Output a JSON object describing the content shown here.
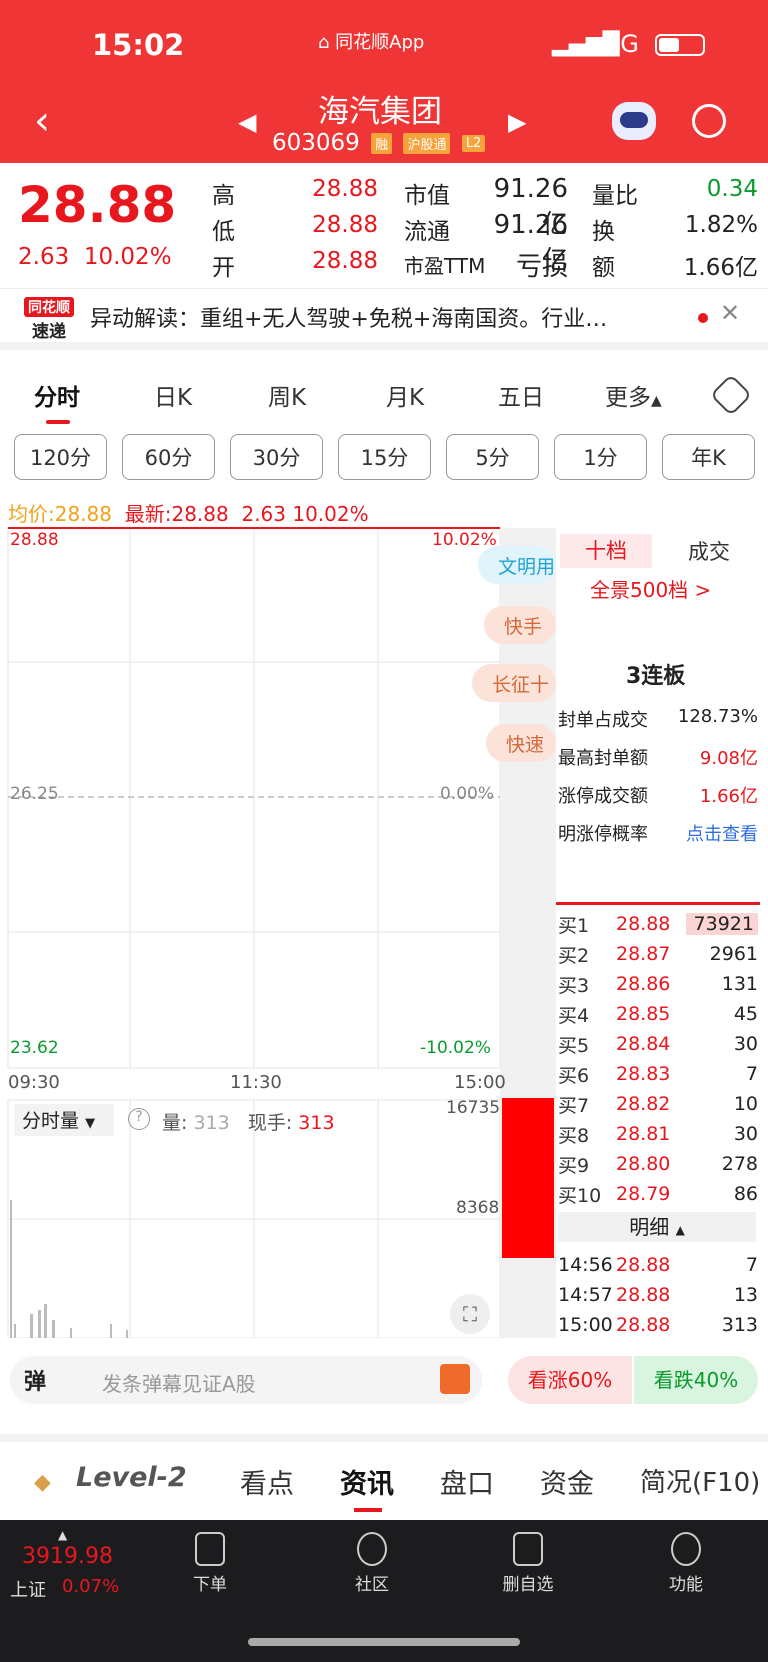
{
  "status_bar": {
    "time": "15:02",
    "app": "同花顺App",
    "network": "4G"
  },
  "header": {
    "name": "海汽集团",
    "code": "603069",
    "tags": [
      "融",
      "沪股通",
      "L2"
    ]
  },
  "quote": {
    "price": "28.88",
    "change": "2.63",
    "pct": "10.02%",
    "grid": [
      [
        "高",
        "28.88",
        "市值",
        "91.26亿",
        "量比",
        "0.34"
      ],
      [
        "低",
        "28.88",
        "流通",
        "91.26亿",
        "换",
        "1.82%"
      ],
      [
        "开",
        "28.88",
        "市盈TTM",
        "亏损",
        "额",
        "1.66亿"
      ]
    ]
  },
  "alert": {
    "logo1": "同花顺",
    "logo2": "速递",
    "text": "异动解读：重组+无人驾驶+免税+海南国资。行业…"
  },
  "tabs": [
    "分时",
    "日K",
    "周K",
    "月K",
    "五日",
    "更多"
  ],
  "periods": [
    "120分",
    "60分",
    "30分",
    "15分",
    "5分",
    "1分",
    "年K"
  ],
  "summary": {
    "avg_label": "均价:",
    "avg": "28.88",
    "latest_label": "最新:",
    "latest": "28.88",
    "chg": "2.63",
    "pct": "10.02%"
  },
  "chart_data": {
    "type": "line",
    "y_top": "28.88",
    "y_mid": "26.25",
    "y_bot": "23.62",
    "pct_top": "10.02%",
    "pct_mid": "0.00%",
    "pct_bot": "-10.02%",
    "x_labels": [
      "09:30",
      "11:30",
      "15:00"
    ],
    "series": [
      {
        "values": [
          28.88,
          28.88
        ]
      }
    ],
    "ylim": [
      23.62,
      28.88
    ]
  },
  "volume": {
    "selector": "分时量",
    "vol_label": "量:",
    "vol": "313",
    "hand_label": "现手:",
    "hand": "313",
    "max": "16735",
    "mid": "8368"
  },
  "news_pills": [
    "文明用",
    "快手",
    "长征十",
    "快速"
  ],
  "side": {
    "tab1": "十档",
    "tab2": "成交",
    "panorama": "全景500档 >",
    "board": "3连板",
    "stats": [
      [
        "封单占成交",
        "128.73%"
      ],
      [
        "最高封单额",
        "9.08亿"
      ],
      [
        "涨停成交额",
        "1.66亿"
      ],
      [
        "明涨停概率",
        "点击查看"
      ]
    ],
    "bids": [
      [
        "买1",
        "28.88",
        "73921"
      ],
      [
        "买2",
        "28.87",
        "2961"
      ],
      [
        "买3",
        "28.86",
        "131"
      ],
      [
        "买4",
        "28.85",
        "45"
      ],
      [
        "买5",
        "28.84",
        "30"
      ],
      [
        "买6",
        "28.83",
        "7"
      ],
      [
        "买7",
        "28.82",
        "10"
      ],
      [
        "买8",
        "28.81",
        "30"
      ],
      [
        "买9",
        "28.80",
        "278"
      ],
      [
        "买10",
        "28.79",
        "86"
      ]
    ],
    "detail_label": "明细",
    "trades": [
      [
        "14:56",
        "28.88",
        "7"
      ],
      [
        "14:57",
        "28.88",
        "13"
      ],
      [
        "15:00",
        "28.88",
        "313"
      ]
    ]
  },
  "danmu": {
    "icon": "弹",
    "placeholder": "发条弹幕见证A股",
    "up": "看涨60%",
    "down": "看跌40%"
  },
  "bottom_tabs": [
    "Level-2",
    "看点",
    "资讯",
    "盘口",
    "资金",
    "简况(F10)"
  ],
  "nav": {
    "index_value": "3919.98",
    "index_name": "上证",
    "index_pct": "0.07%",
    "items": [
      "下单",
      "社区",
      "删自选",
      "功能"
    ]
  }
}
